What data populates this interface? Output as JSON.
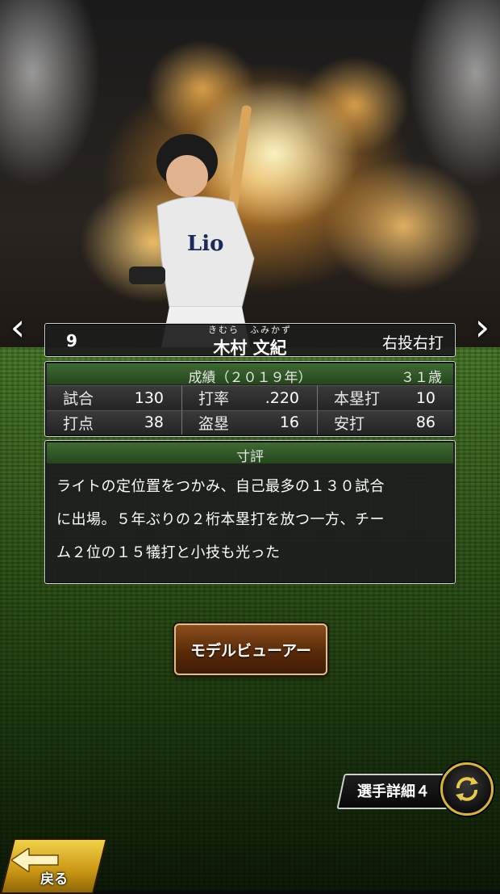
{
  "nav": {
    "prev_icon": "chevron-left-icon",
    "next_icon": "chevron-right-icon"
  },
  "player": {
    "number": "9",
    "ruby": "きむら　ふみかず",
    "name": "木村 文紀",
    "throw_bat": "右投右打"
  },
  "stats": {
    "title": "成績（２０１９年）",
    "age": "３１歳",
    "rows": [
      [
        {
          "label": "試合",
          "value": "130"
        },
        {
          "label": "打率",
          "value": ".220"
        },
        {
          "label": "本塁打",
          "value": "10"
        }
      ],
      [
        {
          "label": "打点",
          "value": "38"
        },
        {
          "label": "盗塁",
          "value": "16"
        },
        {
          "label": "安打",
          "value": "86"
        }
      ]
    ]
  },
  "review": {
    "title": "寸評",
    "lines": [
      "ライトの定位置をつかみ、自己最多の１３０試合",
      "に出場。５年ぶりの２桁本塁打を放つ一方、チー",
      "ム２位の１５犠打と小技も光った"
    ]
  },
  "buttons": {
    "model_viewer": "モデルビューアー",
    "player_detail": "選手詳細４",
    "back": "戻る"
  },
  "colors": {
    "accent_green": "#3f6b33",
    "gold": "#d8b43a",
    "brown": "#5a2a08"
  }
}
